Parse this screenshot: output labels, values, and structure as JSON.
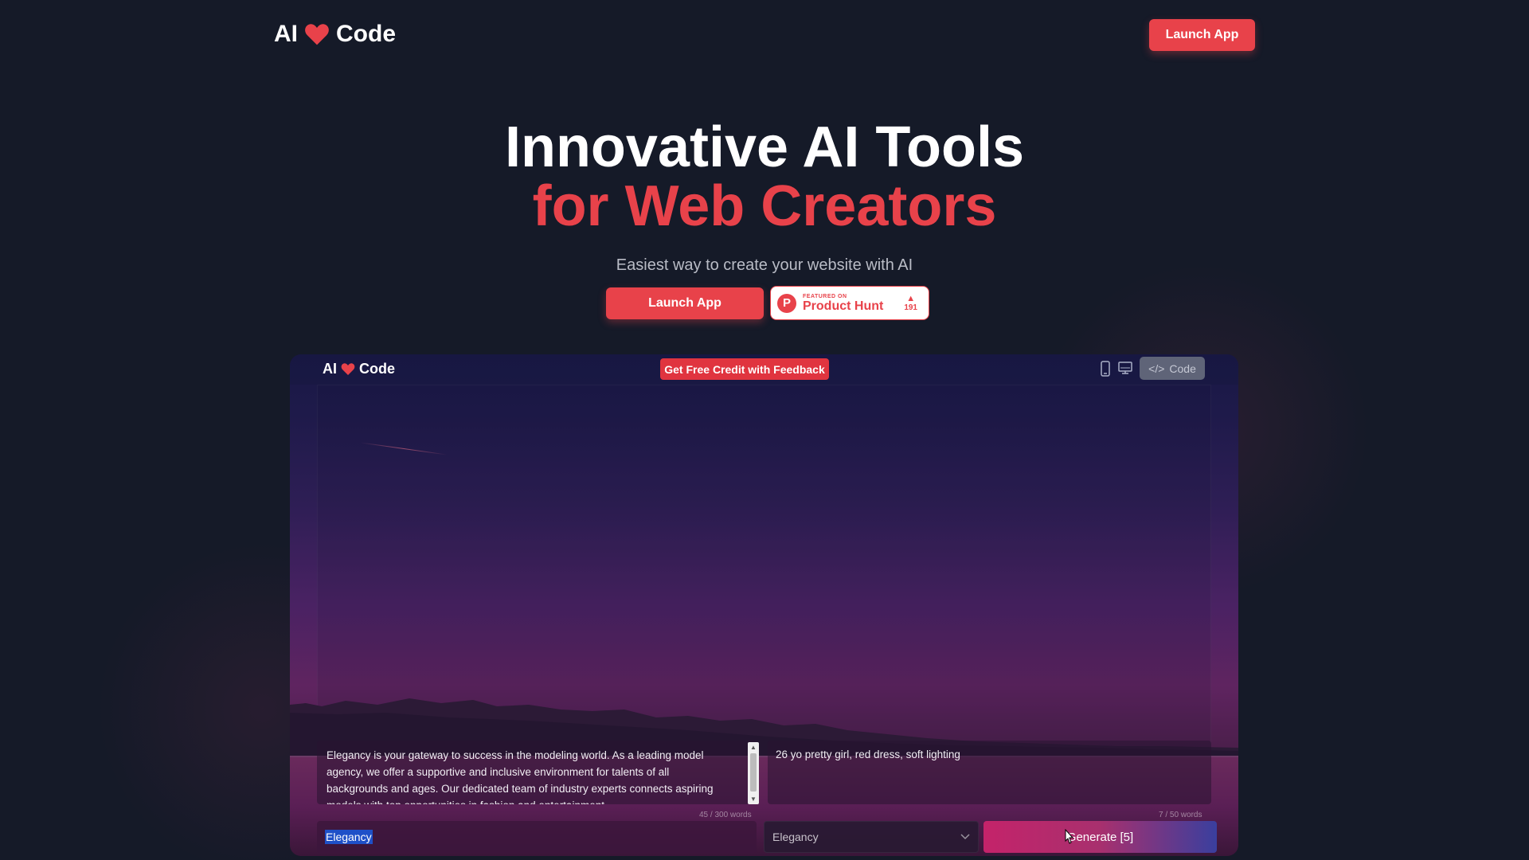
{
  "nav": {
    "logo_left": "AI",
    "logo_right": "Code",
    "launch_label": "Launch App"
  },
  "hero": {
    "title_line1": "Innovative AI Tools",
    "title_line2": "for Web Creators",
    "subtitle": "Easiest way to create your website with AI",
    "launch_label": "Launch App"
  },
  "product_hunt": {
    "featured_on": "FEATURED ON",
    "name": "Product Hunt",
    "votes": "191",
    "logo_letter": "P"
  },
  "preview": {
    "logo_left": "AI",
    "logo_right": "Code",
    "credit_label": "Get Free Credit with Feedback",
    "code_label": "Code",
    "description": "Elegancy is your gateway to success in the modeling world. As a leading model agency, we offer a supportive and inclusive environment for talents of all backgrounds and ages. Our dedicated team of industry experts connects aspiring models with top opportunities in fashion and entertainment.",
    "description_count": "45 / 300 words",
    "prompt": "26 yo pretty girl, red dress, soft lighting",
    "prompt_count": "7 / 50 words",
    "name_value": "Elegancy",
    "style_value": "Elegancy",
    "generate_label": "Generate [5]"
  },
  "colors": {
    "background": "#151a28",
    "accent": "#e8424a",
    "heart": "#e8424a"
  },
  "icons": [
    "heart-icon",
    "mobile-icon",
    "desktop-icon",
    "code-icon",
    "chevron-down-icon",
    "cursor-icon",
    "product-hunt-icon",
    "upvote-icon"
  ]
}
